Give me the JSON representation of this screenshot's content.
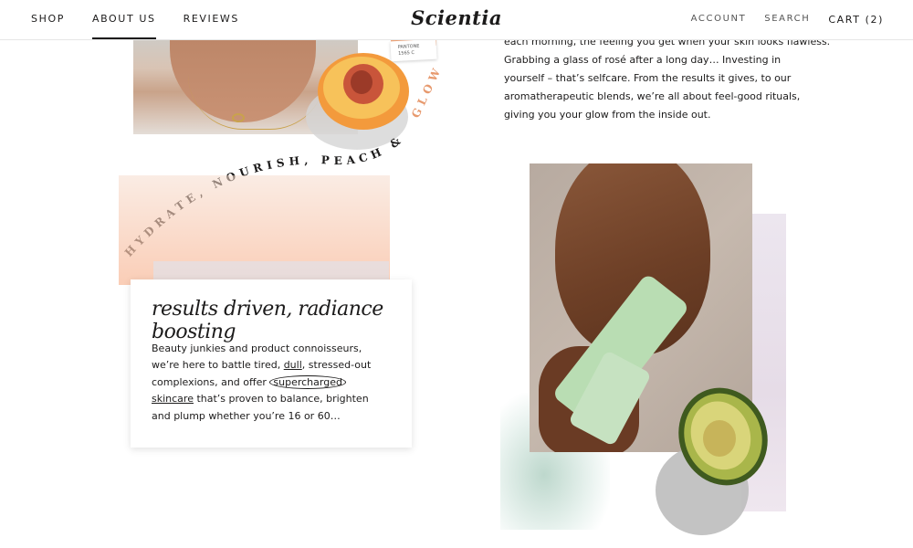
{
  "header": {
    "nav_left": [
      "SHOP",
      "ABOUT US",
      "REVIEWS"
    ],
    "logo": "Scientia",
    "nav_right": {
      "account": "ACCOUNT",
      "search": "SEARCH",
      "cart": "CART (2)"
    }
  },
  "decor": {
    "pantone_line1": "PANTONE",
    "pantone_line2": "1565 C",
    "curved_slogan": "HYDRATE, NOURISH, PEACH &",
    "curved_slogan_end": "GLOW",
    "colors": {
      "peach": "#f3a77a",
      "mint": "#b9ddb3",
      "lavender": "#ece6ef",
      "text": "#1c1b1b"
    }
  },
  "intro": {
    "lines": [
      "each morning, the feeling you get when your skin looks flawless.",
      "Grabbing a glass of rosé after a long day…  Investing in",
      "yourself – that’s selfcare. From the results it gives, to our",
      "aromatherapeutic blends, we’re all about feel-good rituals,",
      "giving you your glow from the inside out."
    ]
  },
  "note": {
    "title": "results driven, radiance boosting",
    "line1": "Beauty junkies and product connoisseurs,",
    "line2a": "we’re here to battle tired, ",
    "line2b": "dull",
    "line2c": ", stressed-out",
    "line3a": "complexions, and offer ",
    "line3b": "supercharged",
    "line4a": "skincare",
    "line4b": " that’s proven to balance, brighten",
    "line5": "and plump whether you’re 16 or 60…"
  }
}
